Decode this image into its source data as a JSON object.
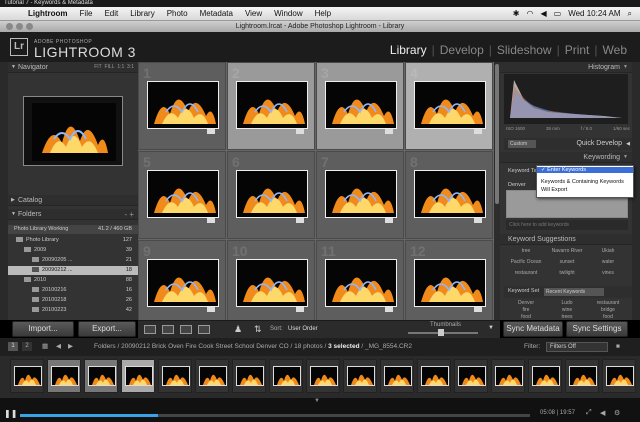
{
  "video_title": "Tutorial 7 - Keywords & Metadata",
  "menubar": {
    "apple": "",
    "items": [
      "Lightroom",
      "File",
      "Edit",
      "Library",
      "Photo",
      "Metadata",
      "View",
      "Window",
      "Help"
    ],
    "clock": "Wed 10:24 AM"
  },
  "window": {
    "title": "Lightroom.lrcat - Adobe Photoshop Lightroom - Library"
  },
  "identity": {
    "logo": "Lr",
    "brand_small": "ADOBE PHOTOSHOP",
    "brand_big": "LIGHTROOM 3",
    "modules": [
      "Library",
      "Develop",
      "Slideshow",
      "Print",
      "Web"
    ],
    "active_module": "Library"
  },
  "left": {
    "navigator": {
      "title": "Navigator",
      "zoom": [
        "FIT",
        "FILL",
        "1:1",
        "3:1"
      ]
    },
    "catalog": "Catalog",
    "folders": {
      "title": "Folders",
      "plusminus": "- +"
    },
    "volume": {
      "name": "Photo Library Working",
      "size": "41.2 / 460 GB"
    },
    "tree": [
      {
        "label": "Photo Library",
        "count": "127"
      },
      {
        "label": "2009",
        "count": "39"
      },
      {
        "label": "20090205 ...",
        "count": "21"
      },
      {
        "label": "20090212 ...",
        "count": "18"
      },
      {
        "label": "2010",
        "count": "88"
      },
      {
        "label": "20100216",
        "count": "16"
      },
      {
        "label": "20100218",
        "count": "26"
      },
      {
        "label": "20100223",
        "count": "42"
      },
      {
        "label": "20100224",
        "count": "4"
      }
    ],
    "import_label": "Import...",
    "export_label": "Export..."
  },
  "grid": {
    "cell_numbers": [
      "1",
      "2",
      "3",
      "4",
      "5",
      "6",
      "7",
      "8",
      "9",
      "10",
      "11",
      "12"
    ]
  },
  "toolbar": {
    "sort_label": "Sort:",
    "sort_value": "User Order",
    "thumbnails_label": "Thumbnails"
  },
  "right": {
    "histogram": {
      "title": "Histogram",
      "iso": "ISO 1600",
      "focal": "35 mm",
      "aperture": "f / 8.0",
      "shutter": "1/60 sec"
    },
    "quick_develop": {
      "title": "Quick Develop",
      "preset": "Custom"
    },
    "keywording": {
      "title": "Keywording",
      "keyword_tags_label": "Keyword Tags",
      "keyword_tags_value": "Enter Keywords",
      "dropdown_options": [
        "Enter Keywords",
        "Keywords & Containing Keywords",
        "Will Export"
      ],
      "add_placeholder": "Click here to add keywords",
      "suggestions_title": "Keyword Suggestions",
      "suggestions": [
        "tree",
        "Navarro River",
        "Ukiah",
        "Pacific Ocean",
        "sunset",
        "water",
        "restaurant",
        "twilight",
        "vines"
      ],
      "set_label": "Keyword Set",
      "set_value": "Recent Keywords",
      "set_items": [
        "Denver",
        "Ludo",
        "restaurant",
        "fire",
        "wine",
        "bridge",
        "food",
        "trees",
        "food"
      ]
    },
    "sync_metadata": "Sync Metadata",
    "sync_settings": "Sync Settings"
  },
  "filmstrip": {
    "pages": [
      "1",
      "2"
    ],
    "path": "Folders / 20090212 Brick Oven Fire Cook Street School Denver CO / 18 photos /",
    "selected": "3 selected",
    "file": "/ _MG_8554.CR2",
    "filter_label": "Filter:",
    "filter_value": "Filters Off"
  },
  "video": {
    "timecode": "05:08 | 19:57",
    "progress": 0.27
  }
}
